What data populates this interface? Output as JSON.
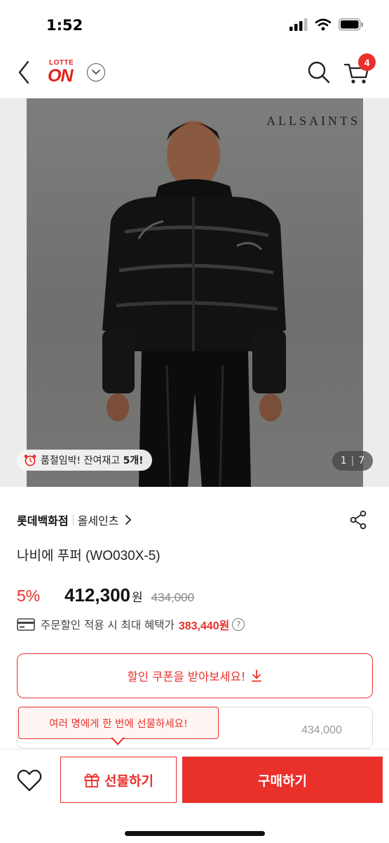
{
  "status_bar": {
    "time": "1:52"
  },
  "header": {
    "logo_top": "LOTTE",
    "logo_main": "ON",
    "cart_count": "4"
  },
  "product_image": {
    "brand_watermark": "ALLSAINTS",
    "stock_notice_prefix": "품절임박! 잔여재고 ",
    "stock_notice_count": "5개!",
    "image_index": "1",
    "image_total": "7"
  },
  "product": {
    "seller": "롯데백화점",
    "brand": "올세인츠",
    "title": "나비에 푸퍼 (WO030X-5)",
    "discount": "5%",
    "price": "412,300",
    "currency": "원",
    "original_price": "434,000",
    "benefit_text": "주문할인 적용 시 최대 혜택가",
    "benefit_price": "383,440원"
  },
  "coupon": {
    "label": "할인 쿠폰을 받아보세요!"
  },
  "gift_tooltip": {
    "text": "여러 명에게 한 번에 선물하세요!"
  },
  "partial_card": {
    "price": "434,000"
  },
  "bottom_bar": {
    "gift_label": "선물하기",
    "buy_label": "구매하기"
  },
  "colors": {
    "accent": "#e9302b",
    "text": "#222222"
  }
}
